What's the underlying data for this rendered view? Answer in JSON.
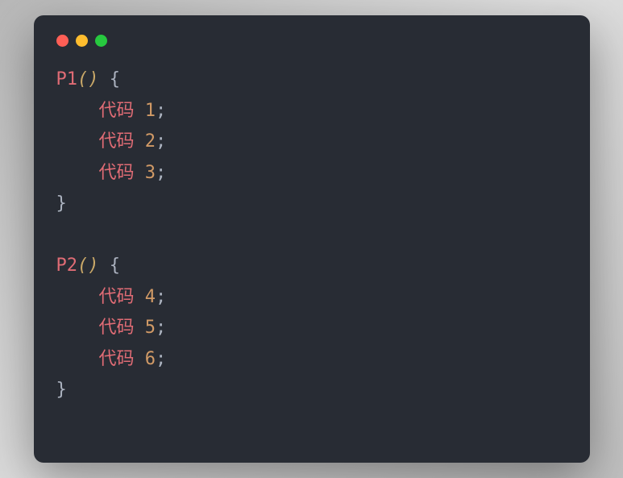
{
  "window": {
    "buttons": [
      "close",
      "minimize",
      "maximize"
    ]
  },
  "code": {
    "functions": [
      {
        "name": "P1",
        "lines": [
          {
            "label": "代码",
            "num": "1"
          },
          {
            "label": "代码",
            "num": "2"
          },
          {
            "label": "代码",
            "num": "3"
          }
        ]
      },
      {
        "name": "P2",
        "lines": [
          {
            "label": "代码",
            "num": "4"
          },
          {
            "label": "代码",
            "num": "5"
          },
          {
            "label": "代码",
            "num": "6"
          }
        ]
      }
    ],
    "open_paren": "(",
    "close_paren": ")",
    "open_brace": "{",
    "close_brace": "}",
    "semicolon": ";",
    "indent": "    "
  }
}
